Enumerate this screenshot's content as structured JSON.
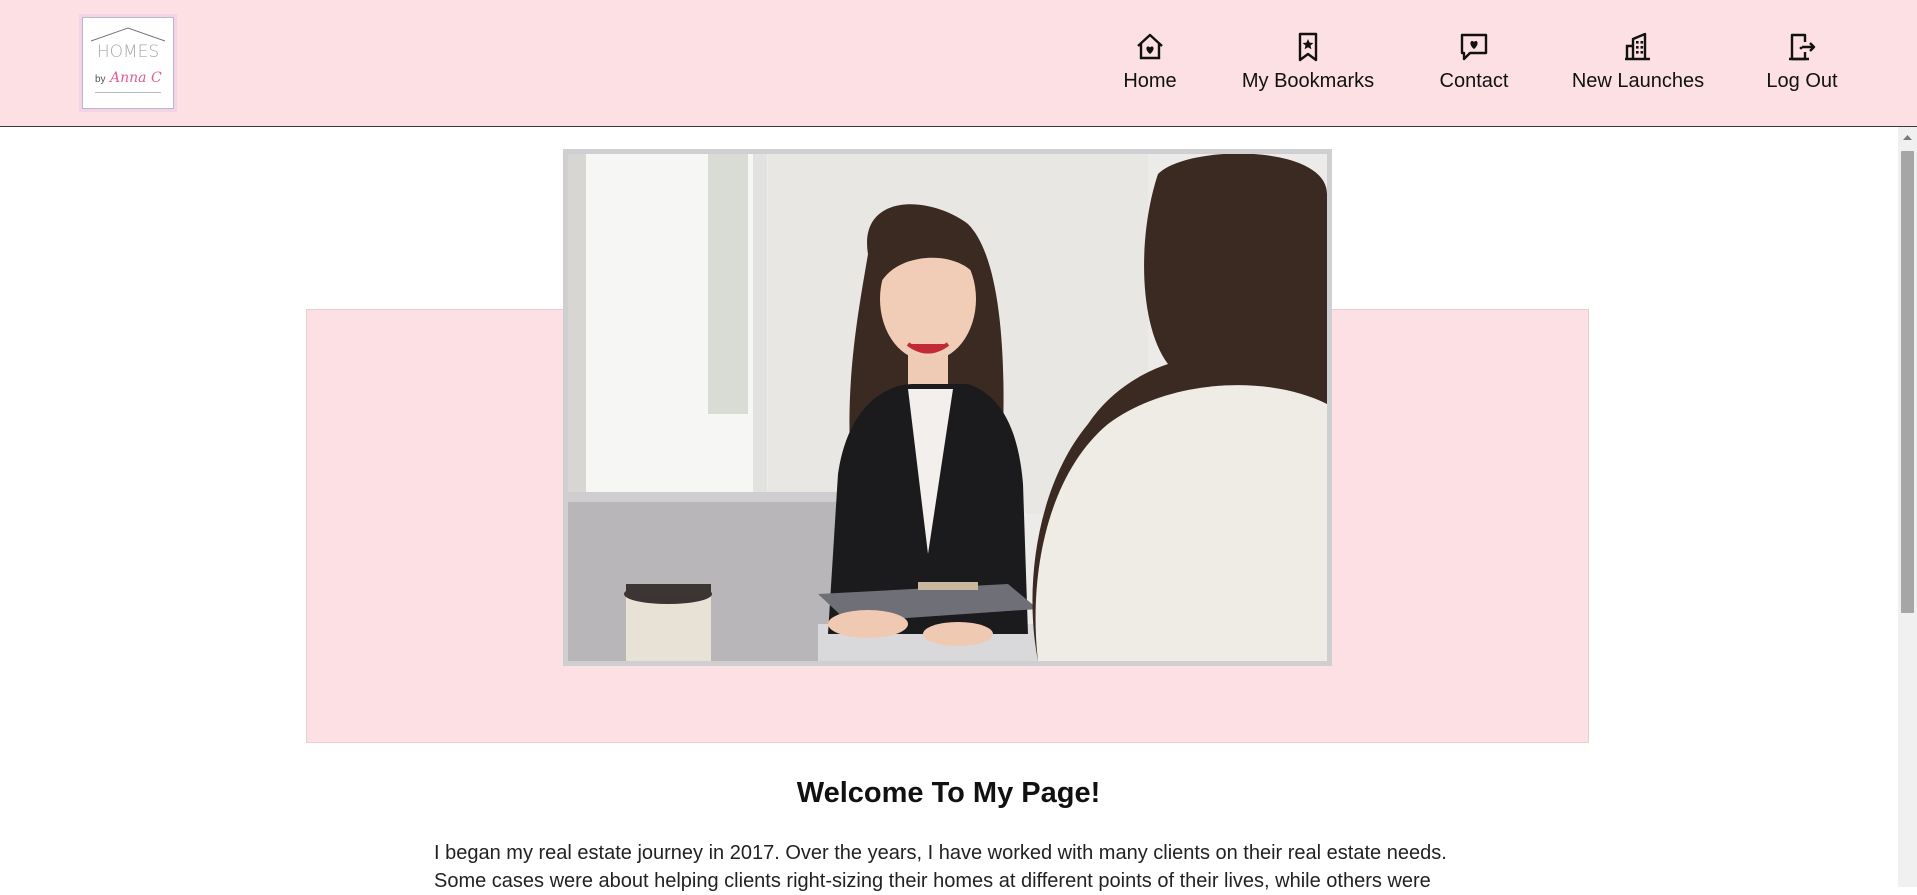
{
  "brand": {
    "logo_word": "HOMES",
    "logo_by": "by",
    "logo_name": "Anna C"
  },
  "nav": {
    "items": [
      {
        "label": "Home",
        "icon": "house-heart-icon"
      },
      {
        "label": "My Bookmarks",
        "icon": "bookmark-star-icon"
      },
      {
        "label": "Contact",
        "icon": "chat-heart-icon"
      },
      {
        "label": "New Launches",
        "icon": "buildings-icon"
      },
      {
        "label": "Log Out",
        "icon": "door-exit-icon"
      }
    ]
  },
  "hero": {
    "image": "two-women-meeting-photo"
  },
  "content": {
    "heading": "Welcome To My Page!",
    "paragraph": "I began my real estate journey in 2017.  Over the years, I have worked with many clients on their real estate needs. Some cases were about helping clients right-sizing their homes at different points of their lives, while others were"
  },
  "colors": {
    "header_bg": "#fde0e3",
    "accent": "#e35d93"
  }
}
